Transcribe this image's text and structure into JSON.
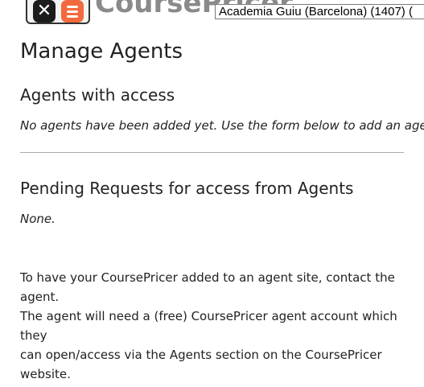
{
  "header": {
    "brand": "CoursePricer",
    "school_select": "Academia Guiu (Barcelona) (1407) ("
  },
  "page": {
    "title": "Manage Agents"
  },
  "agents_with_access": {
    "heading": "Agents with access",
    "empty_message": "No agents have been added yet. Use the form below to add an agent."
  },
  "pending_requests": {
    "heading": "Pending Requests for access from Agents",
    "empty_message": "None."
  },
  "info": {
    "line1": "To have your CoursePricer added to an agent site, contact the agent.",
    "line2": "The agent will need a (free) CoursePricer agent account which they",
    "line3": "can open/access via the Agents section on the CoursePricer website."
  }
}
